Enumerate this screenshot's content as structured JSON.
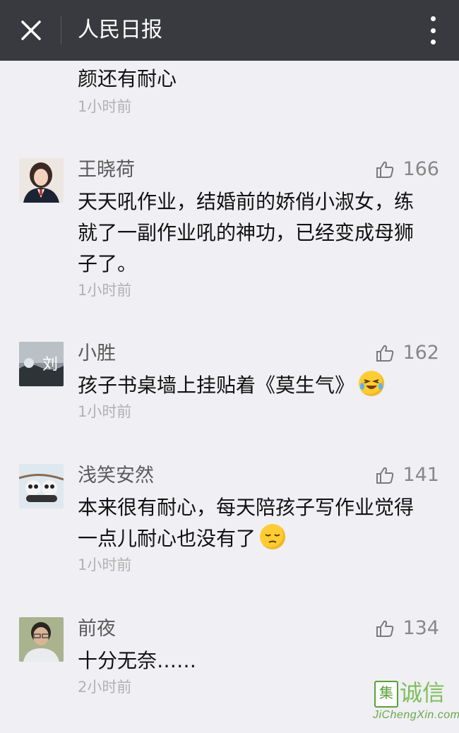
{
  "topbar": {
    "title": "人民日报",
    "close_icon": "close-icon",
    "more_icon": "more-vertical-icon"
  },
  "comments": [
    {
      "name": "",
      "text_lines": [
        "颜还有耐心"
      ],
      "time": "1小时前"
    },
    {
      "name": "王晓荷",
      "likes": "166",
      "text_lines": [
        "天天吼作业，结婚前的娇俏小淑女，练",
        "就了一副作业吼的神功，已经变成母狮",
        "子了。"
      ],
      "time": "1小时前",
      "avatar_text": ""
    },
    {
      "name": "小胜",
      "likes": "162",
      "text_lines": [
        "孩子书桌墙上挂贴着《莫生气》"
      ],
      "emoji": "crying-laughing-emoji",
      "time": "1小时前",
      "avatar_text": "刘"
    },
    {
      "name": "浅笑安然",
      "likes": "141",
      "text_lines": [
        "本来很有耐心，每天陪孩子写作业觉得",
        "一点儿耐心也没有了"
      ],
      "emoji": "pensive-emoji",
      "time": "1小时前"
    },
    {
      "name": "前夜",
      "likes": "134",
      "text_lines": [
        "十分无奈……"
      ],
      "time": "2小时前"
    }
  ],
  "watermark": {
    "logo_char": "集",
    "cn_text": "诚信",
    "en_text": "JiChengXin.com"
  },
  "colors": {
    "topbar": "#393a3f",
    "background": "#efeff4",
    "name": "#5b5b5b",
    "time": "#b2b2b2"
  }
}
